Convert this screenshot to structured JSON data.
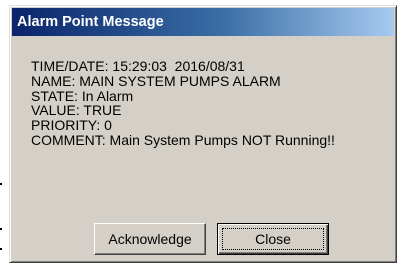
{
  "window": {
    "title": "Alarm Point Message"
  },
  "message": {
    "time_date": "TIME/DATE: 15:29:03  2016/08/31",
    "name": "NAME: MAIN SYSTEM PUMPS ALARM",
    "state": "STATE: In Alarm",
    "value": "VALUE: TRUE",
    "priority": "PRIORITY: 0",
    "comment": "COMMENT: Main System Pumps NOT Running!!"
  },
  "buttons": {
    "acknowledge_label": "Acknowledge",
    "close_label": "Close"
  }
}
